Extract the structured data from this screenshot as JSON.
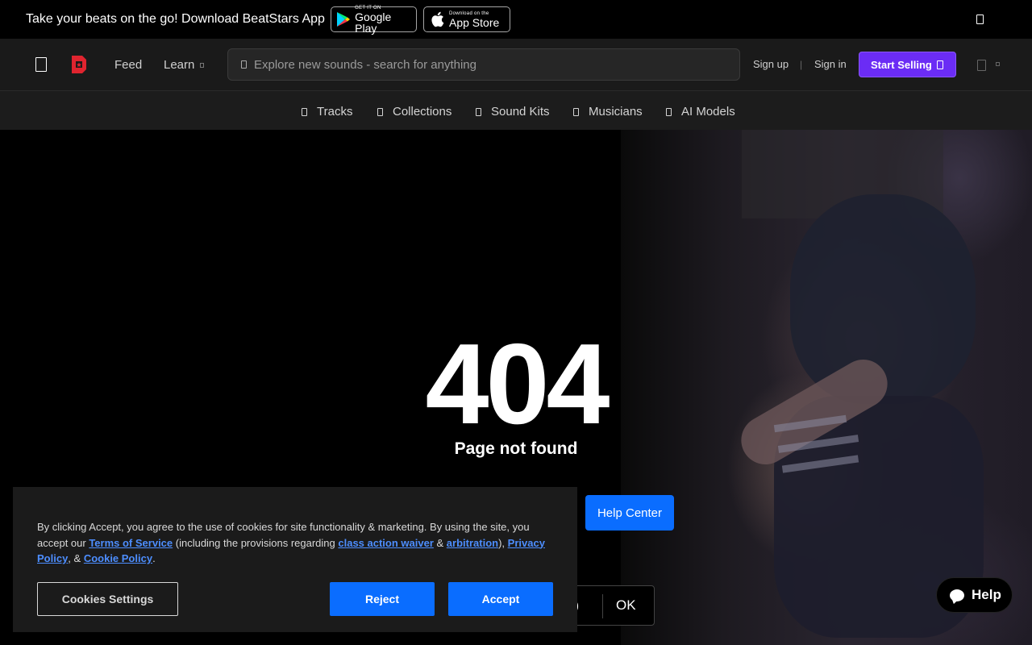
{
  "banner": {
    "text": "Take your beats on the go! Download BeatStars App",
    "google_play": {
      "small": "GET IT ON",
      "big": "Google Play"
    },
    "app_store": {
      "small": "Download on the",
      "big": "App Store"
    }
  },
  "header": {
    "nav": {
      "feed": "Feed",
      "learn": "Learn"
    },
    "search": {
      "placeholder": "Explore new sounds - search for anything"
    },
    "signup": "Sign up",
    "separator": "|",
    "signin": "Sign in",
    "start_selling": "Start Selling"
  },
  "categories": [
    "Tracks",
    "Collections",
    "Sound Kits",
    "Musicians",
    "AI Models"
  ],
  "hero": {
    "code": "404",
    "message": "Page not found",
    "help_center": "Help Center"
  },
  "notice": {
    "paren": ")",
    "ok": "OK"
  },
  "cookie": {
    "text_1": "By clicking Accept, you agree to the use of cookies for site functionality & marketing. By using the site, you accept our ",
    "terms": "Terms of Service",
    "text_2": " (including the provisions regarding ",
    "class_action": "class action waiver",
    "text_3": " & ",
    "arbitration": "arbitration",
    "text_4": "), ",
    "privacy": "Privacy Policy",
    "text_5": ", & ",
    "cookie_policy": "Cookie Policy",
    "text_6": ".",
    "settings": "Cookies Settings",
    "reject": "Reject",
    "accept": "Accept"
  },
  "help_widget": {
    "label": "Help"
  },
  "colors": {
    "accent_purple": "#6b2cf5",
    "accent_blue": "#0a6dff",
    "brand_red": "#e0242f",
    "link_blue": "#4d8eff"
  },
  "icons": [
    "menu-icon",
    "beatstars-logo",
    "search-icon",
    "cart-icon",
    "track-icon",
    "collection-icon",
    "soundkit-icon",
    "musician-icon",
    "ai-model-icon",
    "chat-bubble-icon",
    "close-icon"
  ]
}
